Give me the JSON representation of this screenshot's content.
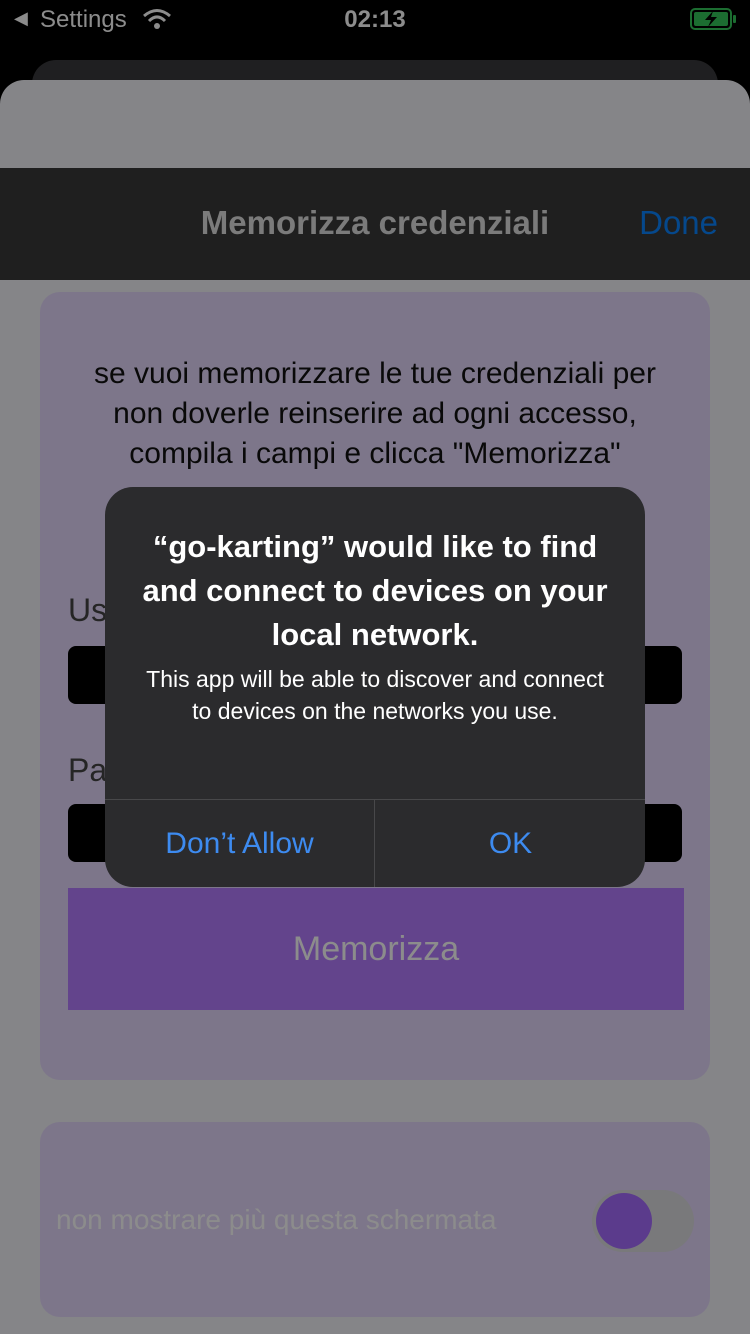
{
  "status_bar": {
    "back_label": "Settings",
    "time": "02:13",
    "battery_state": "charging",
    "battery_color": "#34c759"
  },
  "nav": {
    "title": "Memorizza credenziali",
    "done_label": "Done"
  },
  "card": {
    "intro": "se vuoi memorizzare le tue credenziali per non doverle reinserire ad ogni accesso, compila i campi e clicca \"Memorizza\"",
    "username_label": "Us",
    "password_label": "Pa",
    "save_label": "Memorizza"
  },
  "settings_card": {
    "toggle_label": "non mostrare più questa schermata",
    "toggle_on": false
  },
  "alert": {
    "title": "“go-karting” would like to find and connect to devices on your local network.",
    "message": "This app will be able to discover and connect to devices on the networks you use.",
    "buttons": [
      "Don’t Allow",
      "OK"
    ],
    "button_color": "#3d8bf0"
  }
}
